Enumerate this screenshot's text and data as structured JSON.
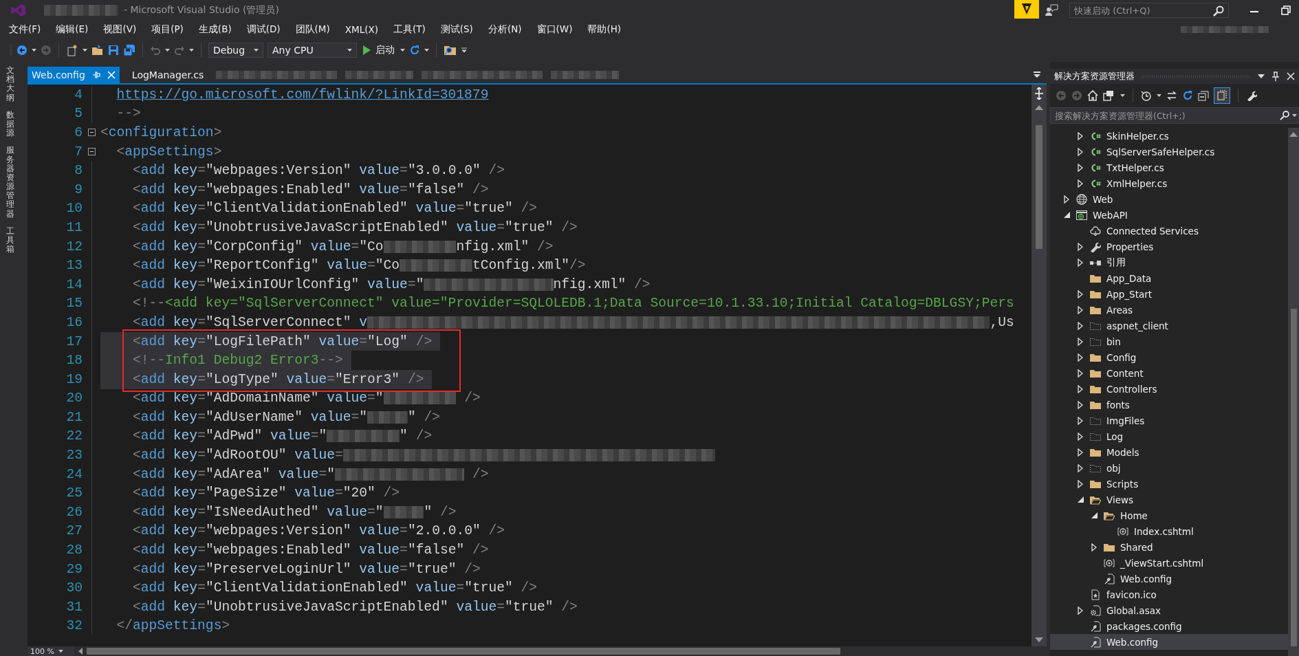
{
  "window": {
    "title": "- Microsoft Visual Studio (管理员)",
    "quick_launch": {
      "placeholder": "快速启动 (Ctrl+Q)"
    }
  },
  "menu": [
    "文件(F)",
    "编辑(E)",
    "视图(V)",
    "项目(P)",
    "生成(B)",
    "调试(D)",
    "团队(M)",
    "XML(X)",
    "工具(T)",
    "测试(S)",
    "分析(N)",
    "窗口(W)",
    "帮助(H)"
  ],
  "toolbar": {
    "configuration": "Debug",
    "platform": "Any CPU",
    "start": "启动"
  },
  "side_tabs": [
    "文档大纲",
    "数据源",
    "服务器资源管理器",
    "工具箱"
  ],
  "tabs": [
    {
      "kind": "file",
      "label": "Web.config",
      "selected": true,
      "pinned": true
    },
    {
      "kind": "file",
      "label": "LogManager.cs",
      "selected": false,
      "pinned": false
    },
    {
      "kind": "blurred"
    },
    {
      "kind": "blurred"
    },
    {
      "kind": "blurred"
    },
    {
      "kind": "blurred"
    }
  ],
  "editor": {
    "zoom": "100 %",
    "lines": [
      {
        "number": "4",
        "kind": "continuation",
        "fold": false,
        "selected": false,
        "boxed": false,
        "segments": [
          {
            "kind": "link",
            "text": "https://go.microsoft.com/fwlink/?LinkId=301879"
          }
        ]
      },
      {
        "number": "5",
        "kind": "code",
        "fold": false,
        "selected": false,
        "boxed": false,
        "segments": [
          {
            "kind": "punct",
            "text": "  -->"
          }
        ]
      },
      {
        "number": "6",
        "kind": "code",
        "fold": true,
        "selected": false,
        "boxed": false,
        "segments": [
          {
            "kind": "punct",
            "text": "<"
          },
          {
            "kind": "tag",
            "text": "configuration"
          },
          {
            "kind": "punct",
            "text": ">"
          }
        ]
      },
      {
        "number": "7",
        "kind": "code",
        "fold": true,
        "selected": false,
        "boxed": false,
        "segments": [
          {
            "kind": "punct",
            "text": "  <"
          },
          {
            "kind": "tag",
            "text": "appSettings"
          },
          {
            "kind": "punct",
            "text": ">"
          }
        ]
      },
      {
        "number": "8",
        "kind": "code",
        "fold": false,
        "selected": false,
        "boxed": false,
        "segments": [
          {
            "kind": "punct",
            "text": "    <"
          },
          {
            "kind": "tag",
            "text": "add"
          },
          {
            "kind": "attr",
            "text": " key"
          },
          {
            "kind": "punct",
            "text": "="
          },
          {
            "kind": "str",
            "text": "\"webpages:Version\""
          },
          {
            "kind": "attr",
            "text": " value"
          },
          {
            "kind": "punct",
            "text": "="
          },
          {
            "kind": "str",
            "text": "\"3.0.0.0\""
          },
          {
            "kind": "punct",
            "text": " />"
          }
        ]
      },
      {
        "number": "9",
        "kind": "code",
        "fold": false,
        "selected": false,
        "boxed": false,
        "segments": [
          {
            "kind": "punct",
            "text": "    <"
          },
          {
            "kind": "tag",
            "text": "add"
          },
          {
            "kind": "attr",
            "text": " key"
          },
          {
            "kind": "punct",
            "text": "="
          },
          {
            "kind": "str",
            "text": "\"webpages:Enabled\""
          },
          {
            "kind": "attr",
            "text": " value"
          },
          {
            "kind": "punct",
            "text": "="
          },
          {
            "kind": "str",
            "text": "\"false\""
          },
          {
            "kind": "punct",
            "text": " />"
          }
        ]
      },
      {
        "number": "10",
        "kind": "code",
        "fold": false,
        "selected": false,
        "boxed": false,
        "segments": [
          {
            "kind": "punct",
            "text": "    <"
          },
          {
            "kind": "tag",
            "text": "add"
          },
          {
            "kind": "attr",
            "text": " key"
          },
          {
            "kind": "punct",
            "text": "="
          },
          {
            "kind": "str",
            "text": "\"ClientValidationEnabled\""
          },
          {
            "kind": "attr",
            "text": " value"
          },
          {
            "kind": "punct",
            "text": "="
          },
          {
            "kind": "str",
            "text": "\"true\""
          },
          {
            "kind": "punct",
            "text": " />"
          }
        ]
      },
      {
        "number": "11",
        "kind": "code",
        "fold": false,
        "selected": false,
        "boxed": false,
        "segments": [
          {
            "kind": "punct",
            "text": "    <"
          },
          {
            "kind": "tag",
            "text": "add"
          },
          {
            "kind": "attr",
            "text": " key"
          },
          {
            "kind": "punct",
            "text": "="
          },
          {
            "kind": "str",
            "text": "\"UnobtrusiveJavaScriptEnabled\""
          },
          {
            "kind": "attr",
            "text": " value"
          },
          {
            "kind": "punct",
            "text": "="
          },
          {
            "kind": "str",
            "text": "\"true\""
          },
          {
            "kind": "punct",
            "text": " />"
          }
        ]
      },
      {
        "number": "12",
        "kind": "code",
        "fold": false,
        "selected": false,
        "boxed": false,
        "segments": [
          {
            "kind": "punct",
            "text": "    <"
          },
          {
            "kind": "tag",
            "text": "add"
          },
          {
            "kind": "attr",
            "text": " key"
          },
          {
            "kind": "punct",
            "text": "="
          },
          {
            "kind": "str",
            "text": "\"CorpConfig\""
          },
          {
            "kind": "attr",
            "text": " value"
          },
          {
            "kind": "punct",
            "text": "="
          },
          {
            "kind": "str",
            "text": "\"Co"
          },
          {
            "kind": "blur"
          },
          {
            "kind": "str",
            "text": "nfig.xml\""
          },
          {
            "kind": "punct",
            "text": " />"
          }
        ]
      },
      {
        "number": "13",
        "kind": "code",
        "fold": false,
        "selected": false,
        "boxed": false,
        "segments": [
          {
            "kind": "punct",
            "text": "    <"
          },
          {
            "kind": "tag",
            "text": "add"
          },
          {
            "kind": "attr",
            "text": " key"
          },
          {
            "kind": "punct",
            "text": "="
          },
          {
            "kind": "str",
            "text": "\"ReportConfig\""
          },
          {
            "kind": "attr",
            "text": " value"
          },
          {
            "kind": "punct",
            "text": "="
          },
          {
            "kind": "str",
            "text": "\"Co"
          },
          {
            "kind": "blur"
          },
          {
            "kind": "str",
            "text": "tConfig.xml\""
          },
          {
            "kind": "punct",
            "text": "/>"
          }
        ]
      },
      {
        "number": "14",
        "kind": "code",
        "fold": false,
        "selected": false,
        "boxed": false,
        "segments": [
          {
            "kind": "punct",
            "text": "    <"
          },
          {
            "kind": "tag",
            "text": "add"
          },
          {
            "kind": "attr",
            "text": " key"
          },
          {
            "kind": "punct",
            "text": "="
          },
          {
            "kind": "str",
            "text": "\"WeixinIOUrlConfig\""
          },
          {
            "kind": "attr",
            "text": " value"
          },
          {
            "kind": "punct",
            "text": "="
          },
          {
            "kind": "str",
            "text": "\""
          },
          {
            "kind": "blur"
          },
          {
            "kind": "str",
            "text": "nfig.xml\""
          },
          {
            "kind": "punct",
            "text": " />"
          }
        ]
      },
      {
        "number": "15",
        "kind": "code",
        "fold": false,
        "selected": false,
        "boxed": false,
        "segments": [
          {
            "kind": "punct",
            "text": "    <!--"
          },
          {
            "kind": "comment",
            "text": "<add key=\"SqlServerConnect\" value=\"Provider=SQLOLEDB.1;Data Source=10.1.33.10;Initial Catalog=DBLGSY;Pers"
          }
        ]
      },
      {
        "number": "16",
        "kind": "code",
        "fold": false,
        "selected": false,
        "boxed": false,
        "segments": [
          {
            "kind": "punct",
            "text": "    <"
          },
          {
            "kind": "tag",
            "text": "add"
          },
          {
            "kind": "attr",
            "text": " key"
          },
          {
            "kind": "punct",
            "text": "="
          },
          {
            "kind": "str",
            "text": "\"SqlServerConnect\""
          },
          {
            "kind": "attr",
            "text": " v"
          },
          {
            "kind": "blur"
          },
          {
            "kind": "str",
            "text": ",Us"
          }
        ]
      },
      {
        "number": "17",
        "kind": "code",
        "fold": false,
        "selected": true,
        "boxed": true,
        "segments": [
          {
            "kind": "punct",
            "text": "    <"
          },
          {
            "kind": "tag",
            "text": "add"
          },
          {
            "kind": "attr",
            "text": " key"
          },
          {
            "kind": "punct",
            "text": "="
          },
          {
            "kind": "str",
            "text": "\"LogFilePath\""
          },
          {
            "kind": "attr",
            "text": " value"
          },
          {
            "kind": "punct",
            "text": "="
          },
          {
            "kind": "str",
            "text": "\"Log\""
          },
          {
            "kind": "punct",
            "text": " />"
          }
        ]
      },
      {
        "number": "18",
        "kind": "code",
        "fold": false,
        "selected": true,
        "boxed": true,
        "segments": [
          {
            "kind": "punct",
            "text": "    <!--"
          },
          {
            "kind": "comment",
            "text": "Info1 Debug2 Error3"
          },
          {
            "kind": "punct",
            "text": "-->"
          }
        ]
      },
      {
        "number": "19",
        "kind": "code",
        "fold": false,
        "selected": true,
        "boxed": true,
        "segments": [
          {
            "kind": "punct",
            "text": "    <"
          },
          {
            "kind": "tag",
            "text": "add"
          },
          {
            "kind": "attr",
            "text": " key"
          },
          {
            "kind": "punct",
            "text": "="
          },
          {
            "kind": "str",
            "text": "\"LogType\""
          },
          {
            "kind": "attr",
            "text": " value"
          },
          {
            "kind": "punct",
            "text": "="
          },
          {
            "kind": "str",
            "text": "\"Error3\""
          },
          {
            "kind": "punct",
            "text": " />"
          }
        ]
      },
      {
        "number": "20",
        "kind": "code",
        "fold": false,
        "selected": false,
        "boxed": false,
        "segments": [
          {
            "kind": "punct",
            "text": "    <"
          },
          {
            "kind": "tag",
            "text": "add"
          },
          {
            "kind": "attr",
            "text": " key"
          },
          {
            "kind": "punct",
            "text": "="
          },
          {
            "kind": "str",
            "text": "\"AdDomainName\""
          },
          {
            "kind": "attr",
            "text": " value"
          },
          {
            "kind": "punct",
            "text": "="
          },
          {
            "kind": "str",
            "text": "\""
          },
          {
            "kind": "blur"
          },
          {
            "kind": "punct",
            "text": " />"
          }
        ]
      },
      {
        "number": "21",
        "kind": "code",
        "fold": false,
        "selected": false,
        "boxed": false,
        "segments": [
          {
            "kind": "punct",
            "text": "    <"
          },
          {
            "kind": "tag",
            "text": "add"
          },
          {
            "kind": "attr",
            "text": " key"
          },
          {
            "kind": "punct",
            "text": "="
          },
          {
            "kind": "str",
            "text": "\"AdUserName\""
          },
          {
            "kind": "attr",
            "text": " value"
          },
          {
            "kind": "punct",
            "text": "="
          },
          {
            "kind": "str",
            "text": "\""
          },
          {
            "kind": "blur"
          },
          {
            "kind": "str",
            "text": "\""
          },
          {
            "kind": "punct",
            "text": " />"
          }
        ]
      },
      {
        "number": "22",
        "kind": "code",
        "fold": false,
        "selected": false,
        "boxed": false,
        "segments": [
          {
            "kind": "punct",
            "text": "    <"
          },
          {
            "kind": "tag",
            "text": "add"
          },
          {
            "kind": "attr",
            "text": " key"
          },
          {
            "kind": "punct",
            "text": "="
          },
          {
            "kind": "str",
            "text": "\"AdPwd\""
          },
          {
            "kind": "attr",
            "text": " value"
          },
          {
            "kind": "punct",
            "text": "="
          },
          {
            "kind": "str",
            "text": "\""
          },
          {
            "kind": "blur"
          },
          {
            "kind": "str",
            "text": "\""
          },
          {
            "kind": "punct",
            "text": " />"
          }
        ]
      },
      {
        "number": "23",
        "kind": "code",
        "fold": false,
        "selected": false,
        "boxed": false,
        "segments": [
          {
            "kind": "punct",
            "text": "    <"
          },
          {
            "kind": "tag",
            "text": "add"
          },
          {
            "kind": "attr",
            "text": " key"
          },
          {
            "kind": "punct",
            "text": "="
          },
          {
            "kind": "str",
            "text": "\"AdRootOU\""
          },
          {
            "kind": "attr",
            "text": " value"
          },
          {
            "kind": "punct",
            "text": "="
          },
          {
            "kind": "blur"
          }
        ]
      },
      {
        "number": "24",
        "kind": "code",
        "fold": false,
        "selected": false,
        "boxed": false,
        "segments": [
          {
            "kind": "punct",
            "text": "    <"
          },
          {
            "kind": "tag",
            "text": "add"
          },
          {
            "kind": "attr",
            "text": " key"
          },
          {
            "kind": "punct",
            "text": "="
          },
          {
            "kind": "str",
            "text": "\"AdArea\""
          },
          {
            "kind": "attr",
            "text": " value"
          },
          {
            "kind": "punct",
            "text": "="
          },
          {
            "kind": "str",
            "text": "\""
          },
          {
            "kind": "blur"
          },
          {
            "kind": "punct",
            "text": " />"
          }
        ]
      },
      {
        "number": "25",
        "kind": "code",
        "fold": false,
        "selected": false,
        "boxed": false,
        "segments": [
          {
            "kind": "punct",
            "text": "    <"
          },
          {
            "kind": "tag",
            "text": "add"
          },
          {
            "kind": "attr",
            "text": " key"
          },
          {
            "kind": "punct",
            "text": "="
          },
          {
            "kind": "str",
            "text": "\"PageSize\""
          },
          {
            "kind": "attr",
            "text": " value"
          },
          {
            "kind": "punct",
            "text": "="
          },
          {
            "kind": "str",
            "text": "\"20\""
          },
          {
            "kind": "punct",
            "text": " />"
          }
        ]
      },
      {
        "number": "26",
        "kind": "code",
        "fold": false,
        "selected": false,
        "boxed": false,
        "segments": [
          {
            "kind": "punct",
            "text": "    <"
          },
          {
            "kind": "tag",
            "text": "add"
          },
          {
            "kind": "attr",
            "text": " key"
          },
          {
            "kind": "punct",
            "text": "="
          },
          {
            "kind": "str",
            "text": "\"IsNeedAuthed\""
          },
          {
            "kind": "attr",
            "text": " value"
          },
          {
            "kind": "punct",
            "text": "="
          },
          {
            "kind": "str",
            "text": "\""
          },
          {
            "kind": "blur"
          },
          {
            "kind": "str",
            "text": "\""
          },
          {
            "kind": "punct",
            "text": " />"
          }
        ]
      },
      {
        "number": "27",
        "kind": "code",
        "fold": false,
        "selected": false,
        "boxed": false,
        "segments": [
          {
            "kind": "punct",
            "text": "    <"
          },
          {
            "kind": "tag",
            "text": "add"
          },
          {
            "kind": "attr",
            "text": " key"
          },
          {
            "kind": "punct",
            "text": "="
          },
          {
            "kind": "str",
            "text": "\"webpages:Version\""
          },
          {
            "kind": "attr",
            "text": " value"
          },
          {
            "kind": "punct",
            "text": "="
          },
          {
            "kind": "str",
            "text": "\"2.0.0.0\""
          },
          {
            "kind": "punct",
            "text": " />"
          }
        ]
      },
      {
        "number": "28",
        "kind": "code",
        "fold": false,
        "selected": false,
        "boxed": false,
        "segments": [
          {
            "kind": "punct",
            "text": "    <"
          },
          {
            "kind": "tag",
            "text": "add"
          },
          {
            "kind": "attr",
            "text": " key"
          },
          {
            "kind": "punct",
            "text": "="
          },
          {
            "kind": "str",
            "text": "\"webpages:Enabled\""
          },
          {
            "kind": "attr",
            "text": " value"
          },
          {
            "kind": "punct",
            "text": "="
          },
          {
            "kind": "str",
            "text": "\"false\""
          },
          {
            "kind": "punct",
            "text": " />"
          }
        ]
      },
      {
        "number": "29",
        "kind": "code",
        "fold": false,
        "selected": false,
        "boxed": false,
        "segments": [
          {
            "kind": "punct",
            "text": "    <"
          },
          {
            "kind": "tag",
            "text": "add"
          },
          {
            "kind": "attr",
            "text": " key"
          },
          {
            "kind": "punct",
            "text": "="
          },
          {
            "kind": "str",
            "text": "\"PreserveLoginUrl\""
          },
          {
            "kind": "attr",
            "text": " value"
          },
          {
            "kind": "punct",
            "text": "="
          },
          {
            "kind": "str",
            "text": "\"true\""
          },
          {
            "kind": "punct",
            "text": " />"
          }
        ]
      },
      {
        "number": "30",
        "kind": "code",
        "fold": false,
        "selected": false,
        "boxed": false,
        "segments": [
          {
            "kind": "punct",
            "text": "    <"
          },
          {
            "kind": "tag",
            "text": "add"
          },
          {
            "kind": "attr",
            "text": " key"
          },
          {
            "kind": "punct",
            "text": "="
          },
          {
            "kind": "str",
            "text": "\"ClientValidationEnabled\""
          },
          {
            "kind": "attr",
            "text": " value"
          },
          {
            "kind": "punct",
            "text": "="
          },
          {
            "kind": "str",
            "text": "\"true\""
          },
          {
            "kind": "punct",
            "text": " />"
          }
        ]
      },
      {
        "number": "31",
        "kind": "code",
        "fold": false,
        "selected": false,
        "boxed": false,
        "segments": [
          {
            "kind": "punct",
            "text": "    <"
          },
          {
            "kind": "tag",
            "text": "add"
          },
          {
            "kind": "attr",
            "text": " key"
          },
          {
            "kind": "punct",
            "text": "="
          },
          {
            "kind": "str",
            "text": "\"UnobtrusiveJavaScriptEnabled\""
          },
          {
            "kind": "attr",
            "text": " value"
          },
          {
            "kind": "punct",
            "text": "="
          },
          {
            "kind": "str",
            "text": "\"true\""
          },
          {
            "kind": "punct",
            "text": " />"
          }
        ]
      },
      {
        "number": "32",
        "kind": "code",
        "fold": false,
        "selected": false,
        "boxed": false,
        "segments": [
          {
            "kind": "punct",
            "text": "  </"
          },
          {
            "kind": "tag",
            "text": "appSettings"
          },
          {
            "kind": "punct",
            "text": ">"
          }
        ]
      }
    ]
  },
  "solution_explorer": {
    "title": "解决方案资源管理器",
    "search": {
      "placeholder": "搜索解决方案资源管理器(Ctrl+;)"
    },
    "tree": [
      {
        "children": [
          {
            "label": "SkinHelper.cs",
            "kind": "csharp",
            "expanded": false,
            "selected": false
          },
          {
            "label": "SqlServerSafeHelper.cs",
            "kind": "csharp",
            "expanded": false,
            "selected": false
          },
          {
            "label": "TxtHelper.cs",
            "kind": "csharp",
            "expanded": false,
            "selected": false
          },
          {
            "label": "XmlHelper.cs",
            "kind": "csharp",
            "expanded": false,
            "selected": false
          }
        ]
      },
      {
        "label": "Web",
        "kind": "globe",
        "expanded": false,
        "selected": false
      },
      {
        "label": "WebAPI",
        "kind": "webproject",
        "expanded": true,
        "selected": false,
        "children": [
          {
            "label": "Connected Services",
            "kind": "cloud",
            "selected": false
          },
          {
            "label": "Properties",
            "kind": "wrench",
            "expanded": false,
            "selected": false
          },
          {
            "label": "引用",
            "kind": "references",
            "expanded": false,
            "selected": false
          },
          {
            "label": "App_Data",
            "kind": "folder",
            "selected": false
          },
          {
            "label": "App_Start",
            "kind": "folder",
            "expanded": false,
            "selected": false
          },
          {
            "label": "Areas",
            "kind": "folder",
            "expanded": false,
            "selected": false
          },
          {
            "label": "aspnet_client",
            "kind": "dashed",
            "expanded": false,
            "selected": false
          },
          {
            "label": "bin",
            "kind": "dashed",
            "expanded": false,
            "selected": false
          },
          {
            "label": "Config",
            "kind": "folder",
            "expanded": false,
            "selected": false
          },
          {
            "label": "Content",
            "kind": "folder",
            "expanded": false,
            "selected": false
          },
          {
            "label": "Controllers",
            "kind": "folder",
            "expanded": false,
            "selected": false
          },
          {
            "label": "fonts",
            "kind": "folder",
            "expanded": false,
            "selected": false
          },
          {
            "label": "ImgFiles",
            "kind": "dashed",
            "expanded": false,
            "selected": false
          },
          {
            "label": "Log",
            "kind": "dashed",
            "expanded": false,
            "selected": false
          },
          {
            "label": "Models",
            "kind": "folder",
            "expanded": false,
            "selected": false
          },
          {
            "label": "obj",
            "kind": "dashed",
            "expanded": false,
            "selected": false
          },
          {
            "label": "Scripts",
            "kind": "folder",
            "expanded": false,
            "selected": false
          },
          {
            "label": "Views",
            "kind": "openfolder",
            "expanded": true,
            "selected": false,
            "children": [
              {
                "label": "Home",
                "kind": "openfolder",
                "expanded": true,
                "selected": false,
                "children": [
                  {
                    "label": "Index.cshtml",
                    "kind": "razor",
                    "selected": false
                  }
                ]
              },
              {
                "label": "Shared",
                "kind": "folder",
                "expanded": false,
                "selected": false
              },
              {
                "label": "_ViewStart.cshtml",
                "kind": "razor",
                "selected": false
              },
              {
                "label": "Web.config",
                "kind": "config",
                "selected": false
              }
            ]
          },
          {
            "label": "favicon.ico",
            "kind": "image",
            "selected": false
          },
          {
            "label": "Global.asax",
            "kind": "asax",
            "expanded": false,
            "selected": false
          },
          {
            "label": "packages.config",
            "kind": "config",
            "selected": false
          },
          {
            "label": "Web.config",
            "kind": "config",
            "selected": true
          }
        ]
      }
    ]
  }
}
